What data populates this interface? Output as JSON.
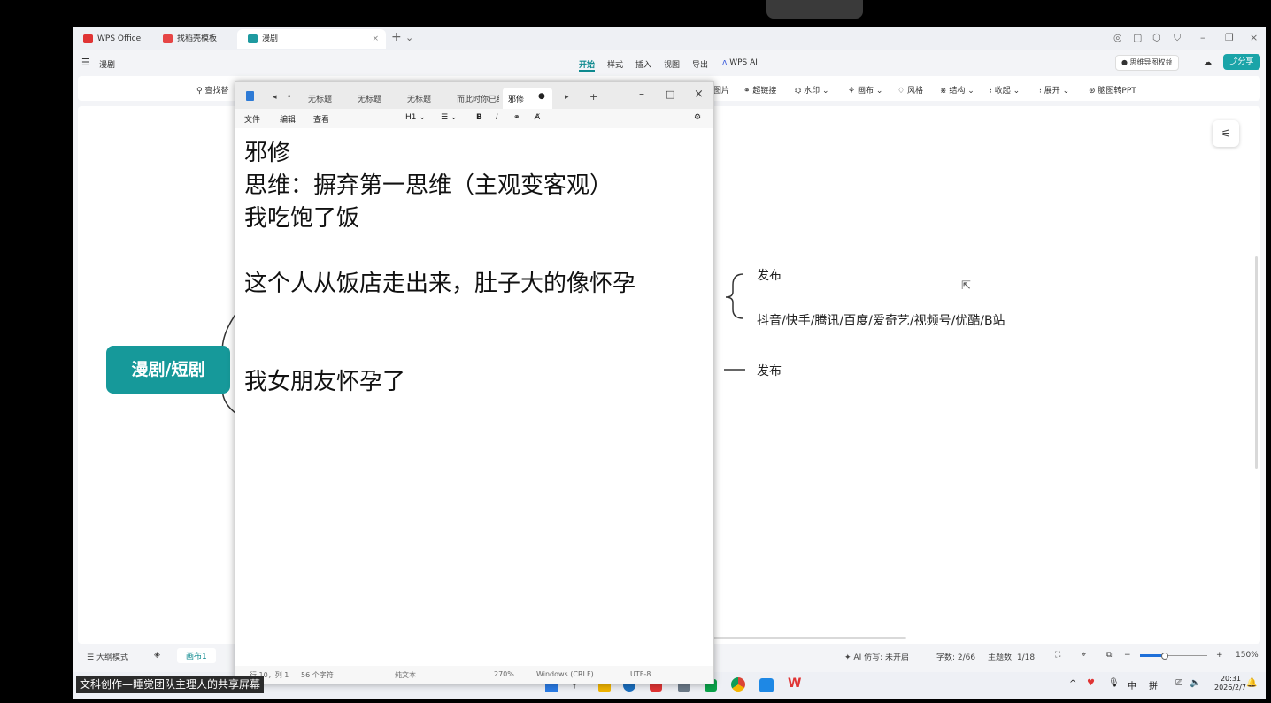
{
  "wps": {
    "tabs": [
      "WPS Office",
      "找稻壳模板",
      "漫剧"
    ],
    "doc_title": "漫剧",
    "menu": [
      "开始",
      "样式",
      "插入",
      "视图",
      "导出",
      "WPS AI"
    ],
    "vip_label": "思维导图权益",
    "share_label": "分享",
    "toolbar": {
      "search": "查找替",
      "image": "图片",
      "hyperlink": "超链接",
      "watermark": "水印",
      "canvas": "画布",
      "style": "风格",
      "structure": "结构",
      "collapse": "收起",
      "expand": "展开",
      "to_ppt": "脑图转PPT"
    },
    "status": {
      "outline_mode": "大纲模式",
      "canvas_tab": "画布1",
      "ai_write": "AI 仿写: 未开启",
      "word_count": "字数: 2/66",
      "topic_count": "主题数: 1/18",
      "zoom": "150%"
    },
    "mindmap": {
      "central": "漫剧/短剧",
      "branch1": "发布",
      "branch2": "抖音/快手/腾讯/百度/爱奇艺/视频号/优酷/B站",
      "branch3": "发布"
    }
  },
  "notepad": {
    "tabs": [
      "无标题",
      "无标题",
      "无标题",
      "而此时你已经",
      "邪修"
    ],
    "menu": [
      "文件",
      "编辑",
      "查看"
    ],
    "format": {
      "heading": "H1",
      "bold": "B",
      "italic": "I"
    },
    "lines": [
      "邪修",
      "思维：摒弃第一思维（主观变客观）",
      "我吃饱了饭",
      "",
      "这个人从饭店走出来，肚子大的像怀孕",
      "",
      "",
      "我女朋友怀孕了"
    ],
    "status": {
      "position": "行 10，列 1",
      "chars": "56 个字符",
      "type": "纯文本",
      "zoom": "270%",
      "line_ending": "Windows (CRLF)",
      "encoding": "UTF-8"
    }
  },
  "taskbar": {
    "time": "20:31",
    "date": "2026/2/7",
    "ime1": "中",
    "ime2": "拼"
  },
  "caption": "文科创作—睡觉团队主理人的共享屏幕",
  "colors": {
    "accent": "#16999a",
    "share": "#1aa4a8"
  }
}
